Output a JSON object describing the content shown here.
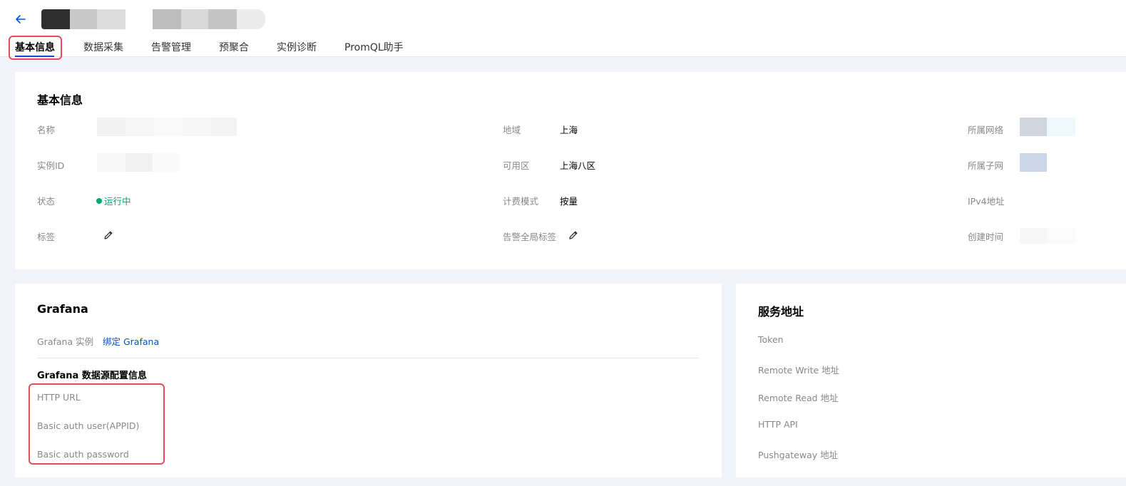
{
  "tabs": [
    {
      "label": "基本信息",
      "active": true
    },
    {
      "label": "数据采集",
      "active": false
    },
    {
      "label": "告警管理",
      "active": false
    },
    {
      "label": "预聚合",
      "active": false
    },
    {
      "label": "实例诊断",
      "active": false
    },
    {
      "label": "PromQL助手",
      "active": false
    }
  ],
  "basic": {
    "title": "基本信息",
    "name_label": "名称",
    "id_label": "实例ID",
    "status_label": "状态",
    "status_value": "运行中",
    "tags_label": "标签",
    "region_label": "地域",
    "region_value": "上海",
    "zone_label": "可用区",
    "zone_value": "上海八区",
    "billing_label": "计费模式",
    "billing_value": "按量",
    "alert_tags_label": "告警全局标签",
    "vpc_label": "所属网络",
    "subnet_label": "所属子网",
    "ipv4_label": "IPv4地址",
    "created_label": "创建时间"
  },
  "grafana": {
    "title": "Grafana",
    "instance_label": "Grafana 实例",
    "bind_link": "绑定 Grafana",
    "ds_title": "Grafana 数据源配置信息",
    "http_url_label": "HTTP URL",
    "basic_user_label": "Basic auth user(APPID)",
    "basic_password_label": "Basic auth password"
  },
  "service": {
    "title": "服务地址",
    "token_label": "Token",
    "remote_write_label": "Remote Write 地址",
    "remote_read_label": "Remote Read 地址",
    "http_api_label": "HTTP API",
    "pushgateway_label": "Pushgateway 地址"
  },
  "colors": {
    "accent": "#0052d9",
    "success": "#00a870",
    "highlight": "#e34d59"
  },
  "icons": [
    "arrow-left-icon",
    "edit-icon"
  ]
}
